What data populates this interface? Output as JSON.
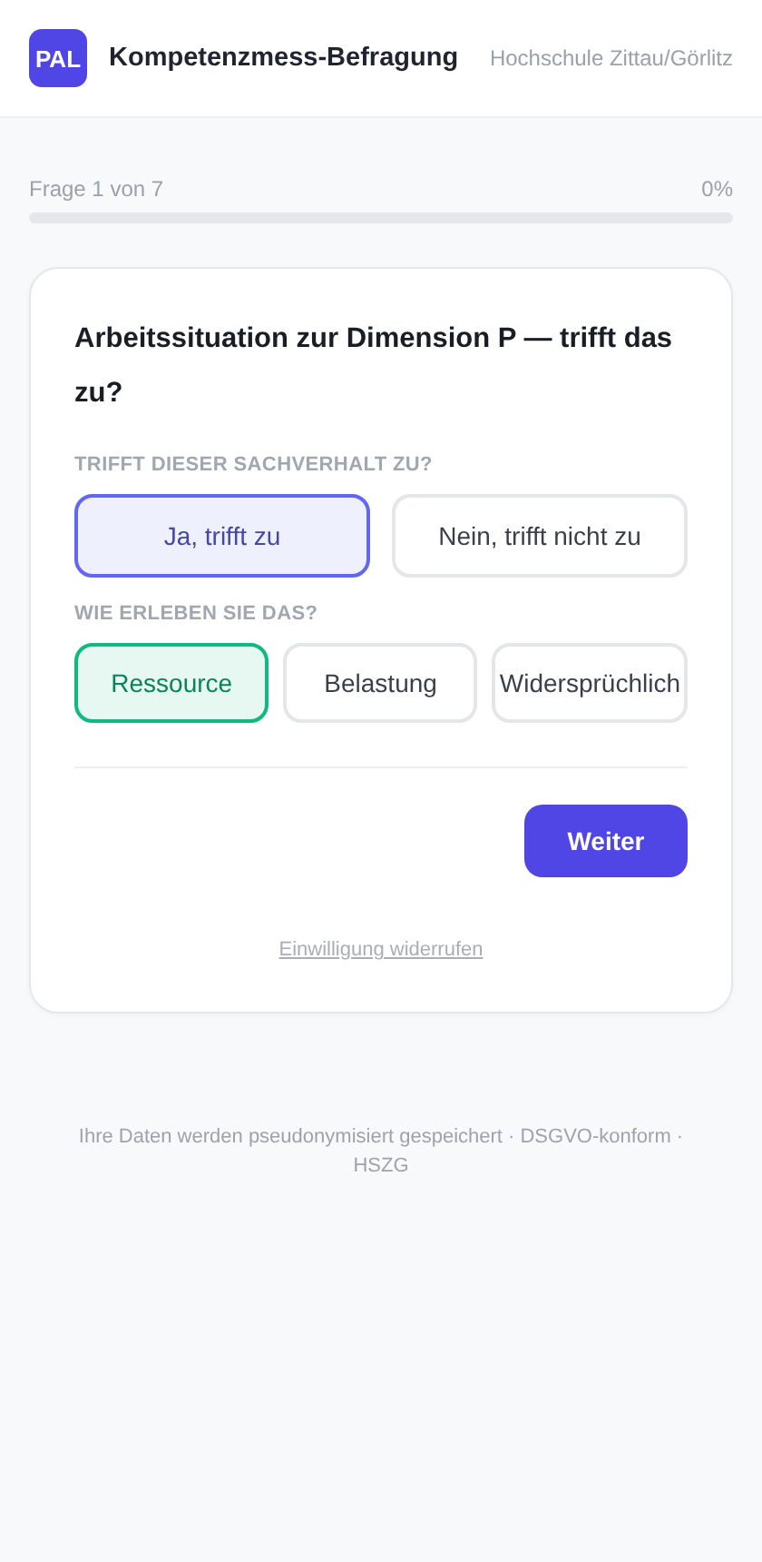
{
  "header": {
    "logo": "PAL",
    "title": "Kompetenzmess-Befragung",
    "institution": "Hochschule Zittau/Görlitz"
  },
  "progress": {
    "label": "Frage 1 von 7",
    "percent": "0%",
    "level": 0
  },
  "question": {
    "title": "Arbeitssituation zur Dimension P — trifft das zu?",
    "groups": [
      {
        "label": "TRIFFT DIESER SACHVERHALT ZU?",
        "color": "#6366f1",
        "options": [
          {
            "label": "Ja, trifft zu",
            "selected": true
          },
          {
            "label": "Nein, trifft nicht zu",
            "selected": false
          }
        ]
      },
      {
        "label": "WIE ERLEBEN SIE DAS?",
        "color": "#10b981",
        "options": [
          {
            "label": "Ressource",
            "selected": true
          },
          {
            "label": "Belastung",
            "selected": false
          },
          {
            "label": "Widersprüchlich",
            "selected": false
          }
        ]
      }
    ],
    "next_button": "Weiter",
    "revoke_link": "Einwilligung widerrufen"
  },
  "footer": "Ihre Daten werden pseudonymisiert gespeichert · DSGVO-konform · HSZG"
}
